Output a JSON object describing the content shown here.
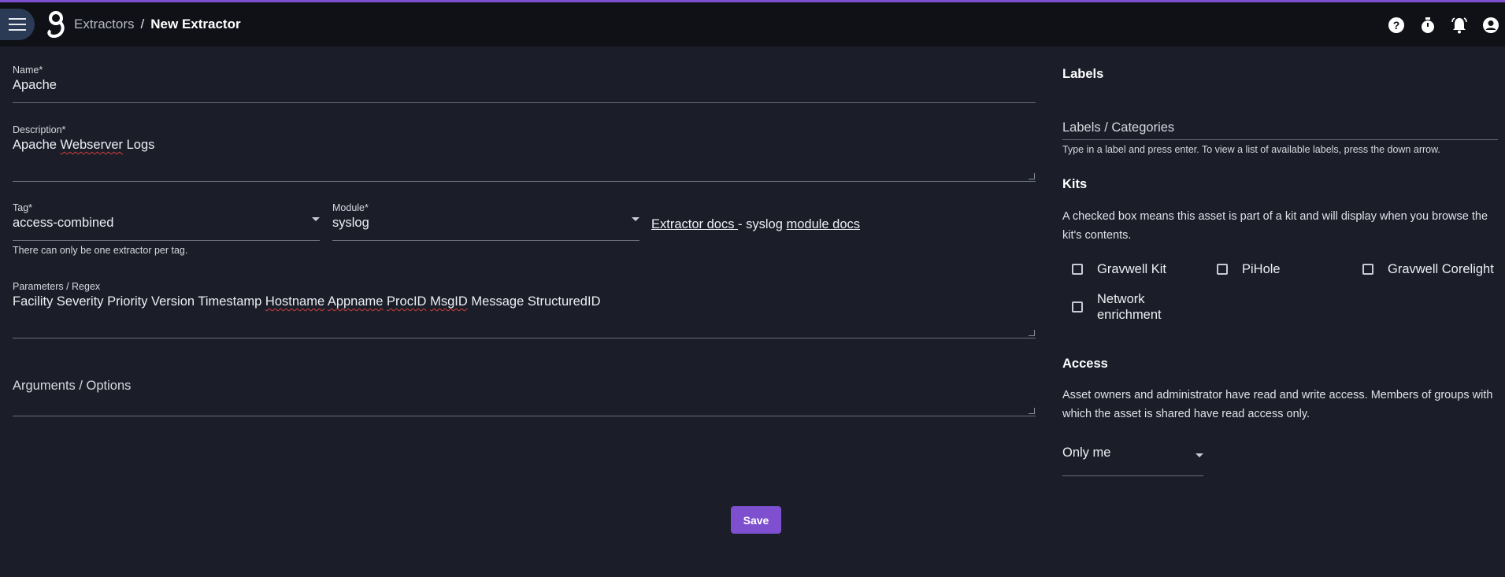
{
  "header": {
    "breadcrumb_parent": "Extractors",
    "breadcrumb_separator": "/",
    "breadcrumb_current": "New Extractor",
    "icons": [
      "menu-icon",
      "gravwell-logo-icon",
      "help-icon",
      "timer-icon",
      "bell-icon",
      "account-icon"
    ],
    "accent_color": "#7e4fcf"
  },
  "form": {
    "name": {
      "label": "Name*",
      "value": "Apache"
    },
    "description": {
      "label": "Description*",
      "value_part1": "Apache ",
      "value_misspelled": "Webserver",
      "value_part2": " Logs"
    },
    "tag": {
      "label": "Tag*",
      "value": "access-combined",
      "helper": "There can only be one extractor per tag."
    },
    "module": {
      "label": "Module*",
      "value": "syslog"
    },
    "docs": {
      "extractor_docs": "Extractor docs ",
      "separator": "- syslog ",
      "module_docs": "module docs"
    },
    "parameters": {
      "label": "Parameters / Regex",
      "segments": [
        {
          "text": "Facility Severity Priority Version Timestamp ",
          "spell": false
        },
        {
          "text": "Hostname",
          "spell": true
        },
        {
          "text": " ",
          "spell": false
        },
        {
          "text": "Appname",
          "spell": true
        },
        {
          "text": " ",
          "spell": false
        },
        {
          "text": "ProcID",
          "spell": true
        },
        {
          "text": " ",
          "spell": false
        },
        {
          "text": "MsgID",
          "spell": true
        },
        {
          "text": " Message StructuredID",
          "spell": false
        }
      ]
    },
    "arguments": {
      "placeholder": "Arguments / Options"
    },
    "save_label": "Save"
  },
  "sidebar": {
    "labels_title": "Labels",
    "labels_placeholder": "Labels / Categories",
    "labels_helper": "Type in a label and press enter. To view a list of available labels, press the down arrow.",
    "kits_title": "Kits",
    "kits_description": "A checked box means this asset is part of a kit and will display when you browse the kit's contents.",
    "kits": [
      {
        "label": "Gravwell Kit",
        "checked": false
      },
      {
        "label": "PiHole",
        "checked": false
      },
      {
        "label": "Gravwell Corelight",
        "checked": false
      },
      {
        "label": "Network enrichment",
        "checked": false
      }
    ],
    "access_title": "Access",
    "access_description": "Asset owners and administrator have read and write access. Members of groups with which the asset is shared have read access only.",
    "access_value": "Only me"
  }
}
